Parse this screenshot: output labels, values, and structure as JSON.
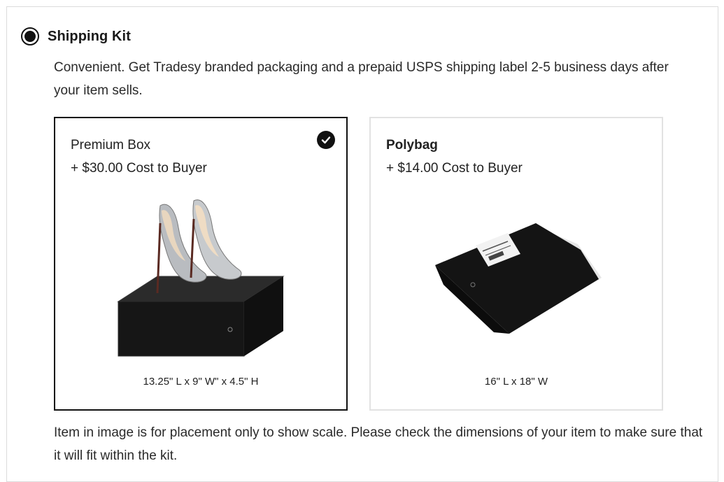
{
  "shipping_option": {
    "title": "Shipping Kit",
    "selected": true,
    "description": "Convenient. Get Tradesy branded packaging and a prepaid USPS shipping label 2-5 business days after your item sells."
  },
  "kits": [
    {
      "name": "Premium Box",
      "cost": "+ $30.00 Cost to Buyer",
      "dimensions": "13.25\" L x 9\" W\" x 4.5\" H",
      "selected": true,
      "icon": "check-icon"
    },
    {
      "name": "Polybag",
      "cost": "+ $14.00 Cost to Buyer",
      "dimensions": "16\" L x 18\" W",
      "selected": false
    }
  ],
  "footnote": "Item in image is for placement only to show scale. Please check the dimensions of your item to make sure that it will fit within the kit.",
  "colors": {
    "selected_border": "#111111",
    "unselected_border": "#e2e2e2",
    "text": "#1a1a1a"
  }
}
